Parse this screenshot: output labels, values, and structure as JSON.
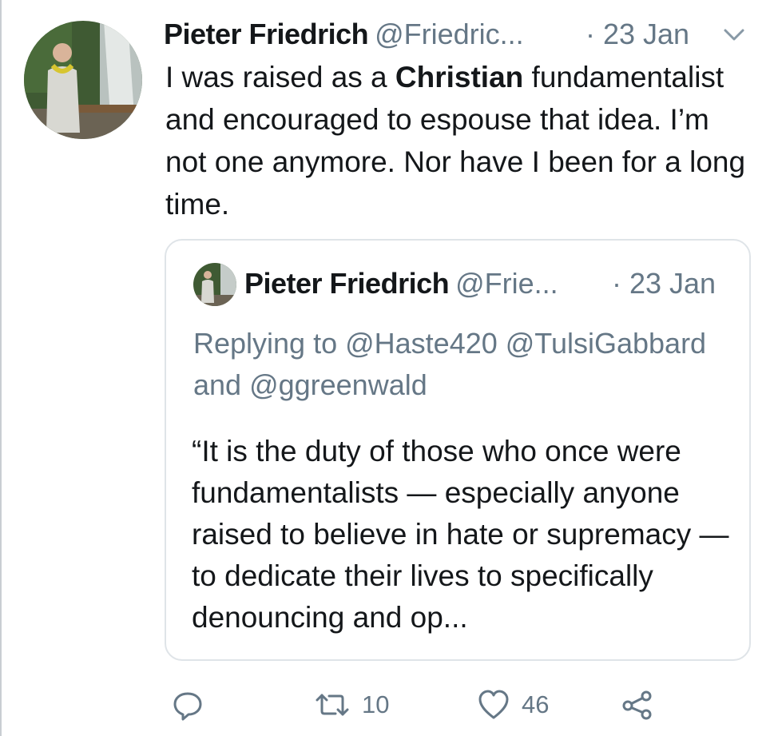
{
  "tweet": {
    "author_name": "Pieter Friedrich",
    "handle": "@Friedric...",
    "date": "· 23 Jan",
    "text_part1": "I was raised as a ",
    "text_bold": "Christian",
    "text_part2": " fundamentalist and encouraged to espouse that idea. I’m not one anymore. Nor have I been for a long time.",
    "menu_icon": "chevron-down-icon"
  },
  "quoted": {
    "author_name": "Pieter Friedrich",
    "handle": "@Frie...",
    "date": "· 23 Jan",
    "replying_to": "Replying to @Haste420 @TulsiGabbard and @ggreenwald",
    "text": "“It is the duty of those who once were fundamentalists — especially anyone raised to believe in hate or supremacy — to dedicate their lives to specifically denouncing and op..."
  },
  "actions": {
    "reply_icon": "reply-icon",
    "retweet_icon": "retweet-icon",
    "retweet_count": "10",
    "like_icon": "heart-icon",
    "like_count": "46",
    "share_icon": "share-icon"
  },
  "colors": {
    "text": "#14171a",
    "secondary": "#657786",
    "border": "#dfe4e8"
  }
}
